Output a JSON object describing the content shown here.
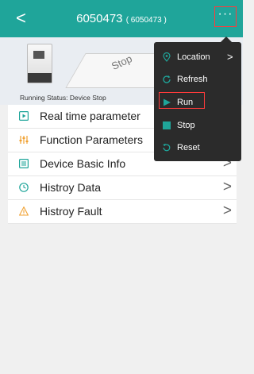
{
  "header": {
    "back_glyph": "<",
    "title": "6050473",
    "subtitle": "( 6050473 )",
    "more_glyph": "···",
    "color": "#1fa59a"
  },
  "banner": {
    "road_label": "Stop",
    "status_text": "Running Status: Device Stop"
  },
  "menu": {
    "items": [
      {
        "label": "Real time parameter",
        "icon": "play-square-icon"
      },
      {
        "label": "Function Parameters",
        "icon": "sliders-icon"
      },
      {
        "label": "Device Basic Info",
        "icon": "document-icon"
      },
      {
        "label": "Histroy Data",
        "icon": "clock-icon"
      },
      {
        "label": "Histroy Fault",
        "icon": "warning-icon"
      }
    ],
    "chevron_glyph": ">"
  },
  "popup": {
    "items": [
      {
        "label": "Location",
        "icon": "location-pin-icon",
        "has_chevron": true
      },
      {
        "label": "Refresh",
        "icon": "refresh-icon"
      },
      {
        "label": "Run",
        "icon": "play-icon",
        "highlighted": true
      },
      {
        "label": "Stop",
        "icon": "stop-icon"
      },
      {
        "label": "Reset",
        "icon": "reset-icon"
      }
    ],
    "chevron_glyph": ">",
    "accent": "#1fa59a",
    "highlight": "#ff3b3b"
  }
}
